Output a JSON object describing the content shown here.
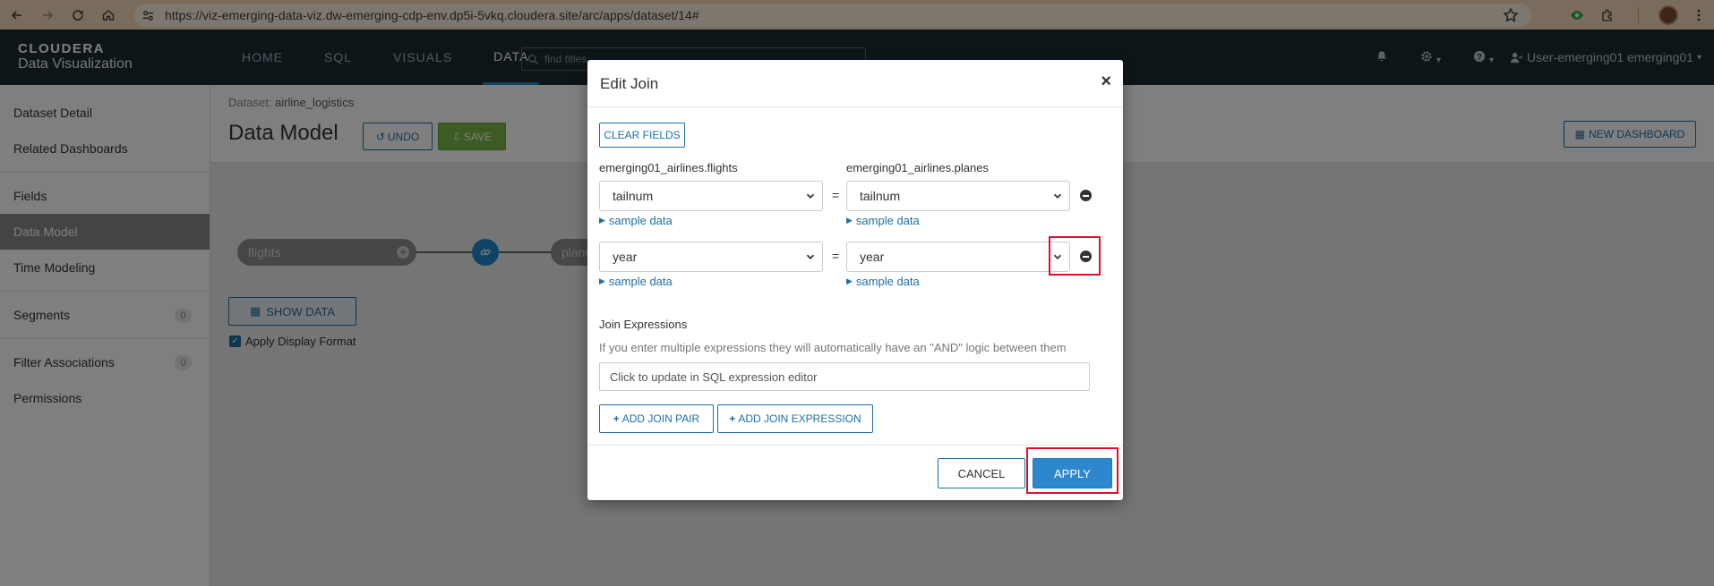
{
  "browser": {
    "url": "https://viz-emerging-data-viz.dw-emerging-cdp-env.dp5i-5vkq.cloudera.site/arc/apps/dataset/14#"
  },
  "app": {
    "logo_top": "CLOUDERA",
    "logo_bottom": "Data Visualization",
    "nav": [
      "HOME",
      "SQL",
      "VISUALS",
      "DATA"
    ],
    "search_placeholder": "find titles",
    "user_label": "User-emerging01 emerging01",
    "caret": "▾"
  },
  "sidebar": {
    "items": [
      {
        "label": "Dataset Detail"
      },
      {
        "label": "Related Dashboards"
      },
      {
        "label": "Fields"
      },
      {
        "label": "Data Model"
      },
      {
        "label": "Time Modeling"
      },
      {
        "label": "Segments",
        "badge": "0"
      },
      {
        "label": "Filter Associations",
        "badge": "0"
      },
      {
        "label": "Permissions"
      }
    ]
  },
  "content": {
    "breadcrumb_prefix": "Dataset:",
    "dataset_name": "airline_logistics",
    "title": "Data Model",
    "undo_label": "UNDO",
    "save_label": "SAVE",
    "new_dashboard_label": "NEW DASHBOARD",
    "node_left": "flights",
    "node_right": "plane",
    "show_data_label": "SHOW DATA",
    "apply_format_label": "Apply Display Format"
  },
  "modal": {
    "title": "Edit Join",
    "close": "×",
    "clear_fields": "CLEAR FIELDS",
    "left_table": "emerging01_airlines.flights",
    "right_table": "emerging01_airlines.planes",
    "equals": "=",
    "sample_data": "sample data",
    "pairs": [
      {
        "left": "tailnum",
        "right": "tailnum"
      },
      {
        "left": "year",
        "right": "year"
      }
    ],
    "join_expressions_title": "Join Expressions",
    "join_expressions_help": "If you enter multiple expressions they will automatically have an \"AND\" logic between them",
    "sql_placeholder": "Click to update in SQL expression editor",
    "add_join_pair": "ADD JOIN PAIR",
    "add_join_expression": "ADD JOIN EXPRESSION",
    "cancel": "CANCEL",
    "apply": "APPLY"
  },
  "colors": {
    "accent": "#1f87c9",
    "header_bg": "#1c2a33",
    "save_green": "#7ab648",
    "highlight_red": "#e0102a"
  }
}
